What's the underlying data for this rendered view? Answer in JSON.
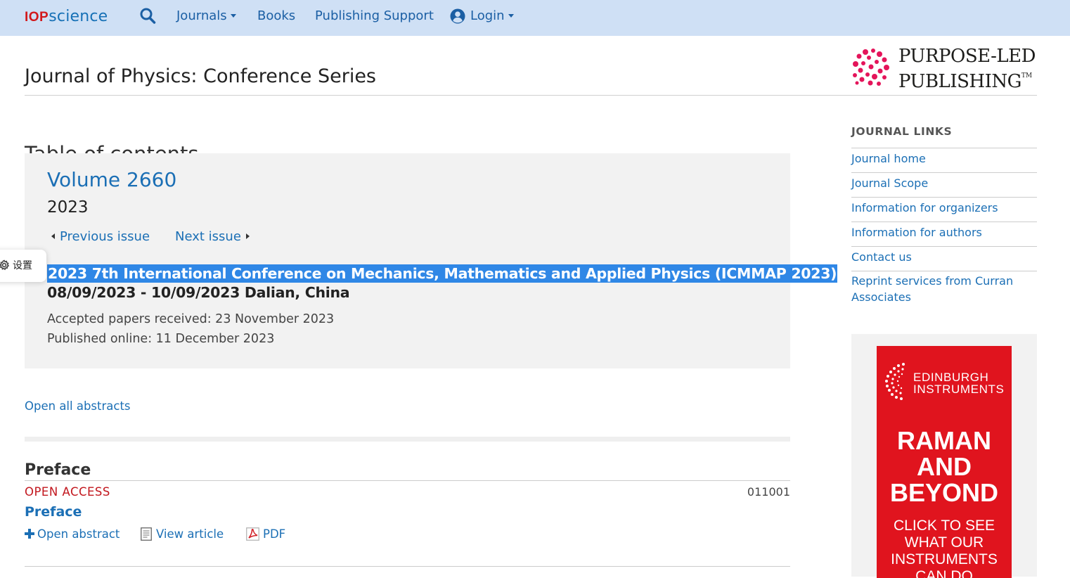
{
  "nav": {
    "logo_iop": "IOP",
    "logo_science": "science",
    "items": [
      {
        "label": "Journals"
      },
      {
        "label": "Books"
      },
      {
        "label": "Publishing Support"
      },
      {
        "label": "Login"
      }
    ]
  },
  "header": {
    "journal_title": "Journal of Physics: Conference Series",
    "publisher_line1": "PURPOSE-LED",
    "publisher_line2": "PUBLISHING",
    "publisher_tm": "TM"
  },
  "toc": {
    "title": "Table of contents",
    "volume": "Volume 2660",
    "year": "2023",
    "prev_issue": "Previous issue",
    "next_issue": "Next issue",
    "conference_name": "2023 7th International Conference on Mechanics, Mathematics and Applied Physics (ICMMAP 2023)",
    "conference_dates": "08/09/2023 - 10/09/2023 Dalian, China",
    "accepted": "Accepted papers received: 23 November 2023",
    "published": "Published online: 11 December 2023"
  },
  "settings_widget": {
    "label": "设置"
  },
  "open_all_abstracts": "Open all abstracts",
  "section": {
    "heading": "Preface",
    "article": {
      "access": "OPEN ACCESS",
      "number": "011001",
      "title": "Preface",
      "open_abstract": "Open abstract",
      "view_article": "View article",
      "pdf": "PDF"
    }
  },
  "sidebar": {
    "heading": "JOURNAL LINKS",
    "links": [
      {
        "label": "Journal home"
      },
      {
        "label": "Journal Scope"
      },
      {
        "label": "Information for organizers"
      },
      {
        "label": "Information for authors"
      },
      {
        "label": "Contact us"
      },
      {
        "label": "Reprint services from Curran Associates"
      }
    ]
  },
  "ad": {
    "brand_line1": "EDINBURGH",
    "brand_line2": "INSTRUMENTS",
    "headline_line1": "RAMAN",
    "headline_line2": "AND",
    "headline_line3": "BEYOND",
    "cta_line1": "CLICK TO SEE",
    "cta_line2": "WHAT OUR",
    "cta_line3": "INSTRUMENTS",
    "cta_line4": "CAN DO"
  },
  "colors": {
    "nav_bg": "#cfe0f5",
    "link": "#1b6fb5",
    "open_access": "#c2171e",
    "selection": "#2f87e6",
    "ad_red": "#e0141e"
  },
  "icons": [
    "search-icon",
    "chevron-down-icon",
    "user-circle-icon",
    "gear-icon",
    "plus-icon",
    "document-icon",
    "pdf-icon",
    "triangle-left-icon",
    "triangle-right-icon"
  ]
}
